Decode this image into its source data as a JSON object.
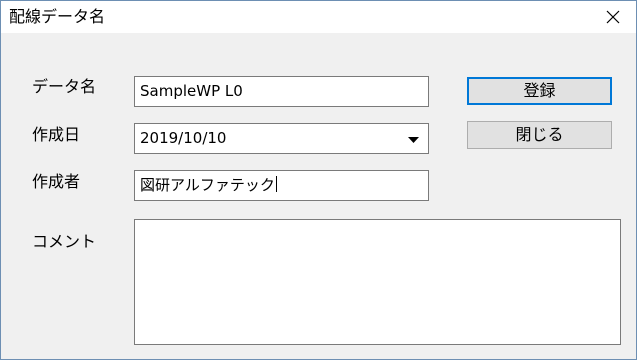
{
  "window": {
    "title": "配線データ名"
  },
  "form": {
    "name_label": "データ名",
    "name_value": "SampleWP L0",
    "date_label": "作成日",
    "date_value": "2019/10/10",
    "author_label": "作成者",
    "author_value": "図研アルファテック",
    "comment_label": "コメント",
    "comment_value": ""
  },
  "buttons": {
    "register_label": "登録",
    "close_label": "閉じる"
  },
  "icons": {
    "close": "close-icon",
    "dropdown": "chevron-down-icon"
  },
  "colors": {
    "window_border": "#6d8fb3",
    "client_bg": "#f0f0f0",
    "button_face": "#e1e1e1",
    "focus_accent": "#0078d7"
  }
}
